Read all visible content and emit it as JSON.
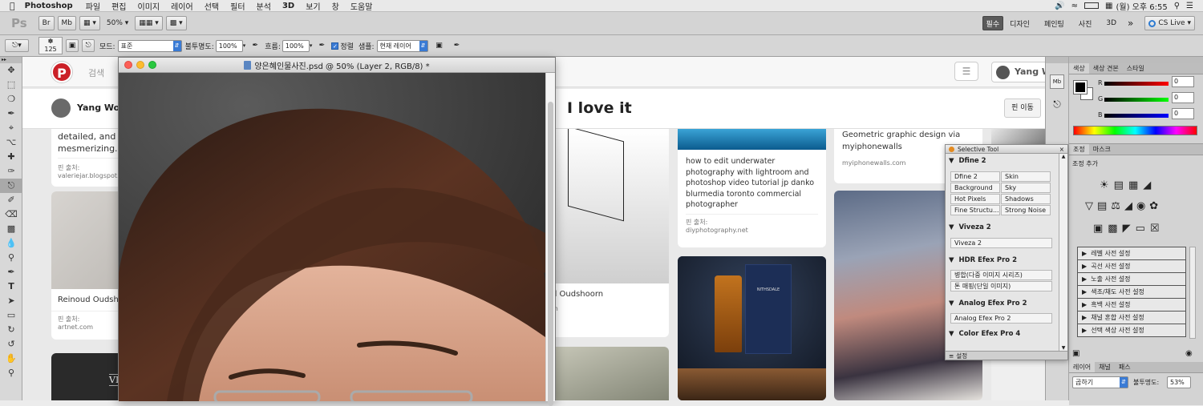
{
  "menubar": {
    "apple": "",
    "app": "Photoshop",
    "items": [
      "파일",
      "편집",
      "이미지",
      "레이어",
      "선택",
      "필터",
      "분석",
      "3D",
      "보기",
      "창",
      "도움말"
    ],
    "status": {
      "clock": "(월) 오후 6:55"
    }
  },
  "appbar": {
    "ps_logo": "Ps",
    "zoom": "50%",
    "workspaces": [
      "필수",
      "디자인",
      "페인팅",
      "사진",
      "3D"
    ],
    "more": "»",
    "cslive": "CS Live"
  },
  "options": {
    "brush_size": "125",
    "mode_label": "모드:",
    "mode_value": "표준",
    "opacity_label": "불투명도:",
    "opacity_value": "100%",
    "flow_label": "흐름:",
    "flow_value": "100%",
    "aligned_label": "정렬",
    "sample_label": "샘플:",
    "sample_value": "현재 레이어"
  },
  "pinterest": {
    "search_placeholder": "검색",
    "user": "Yang Woo",
    "user_short": "Yang W",
    "heading": "I love it",
    "move_pin": "핀 이동",
    "cards": [
      {
        "text": "detailed, and just mesmerizing.",
        "src_label": "핀 출처:",
        "src": "valeriejar.blogspot.co"
      },
      {
        "text": "Reinoud Oudshoo",
        "src_label": "핀 출처:",
        "src": "artnet.com"
      },
      {
        "text": "d Oudshoorn",
        "src": "m"
      },
      {
        "text": "how to edit underwater photography with lightroom and photoshop video tutorial jp danko blurmedia toronto commercial photographer",
        "src_label": "핀 출처:",
        "src": "diyphotography.net"
      },
      {
        "text": "Geometric graphic design via myiphonewalls",
        "src_label": "핀 출처:",
        "src": "myiphonewalls.com"
      }
    ],
    "dark_card_text1": "fr",
    "dark_card_text2": "VIDEO T",
    "bottle_label": "NITHSDALE"
  },
  "document": {
    "title": "양은혜인물사진.psd @ 50% (Layer 2, RGB/8) *"
  },
  "color_panel": {
    "tabs": [
      "색상",
      "색상 견본",
      "스타일"
    ],
    "r_label": "R",
    "r": "0",
    "g_label": "G",
    "g": "0",
    "b_label": "B",
    "b": "0"
  },
  "adjust_panel": {
    "tabs": [
      "조정",
      "마스크"
    ],
    "title": "조정 추가",
    "presets": [
      "레벨 사전 설정",
      "곡선 사전 설정",
      "노출 사전 설정",
      "색조/채도 사전 설정",
      "흑백 사전 설정",
      "채널 혼합 사전 설정",
      "선택 색상 사전 설정"
    ]
  },
  "layers_panel": {
    "tabs": [
      "레이어",
      "채널",
      "패스"
    ],
    "blend": "곱하기",
    "opacity_label": "불투명도:",
    "opacity": "53%"
  },
  "selective_tool": {
    "title": "Selective Tool",
    "groups": [
      {
        "name": "Dfine 2",
        "buttons": [
          "Dfine 2",
          "Skin",
          "Background",
          "Sky",
          "Hot Pixels",
          "Shadows",
          "Fine Structu...",
          "Strong Noise"
        ]
      },
      {
        "name": "Viveza 2",
        "buttons": [
          "Viveza 2"
        ]
      },
      {
        "name": "HDR Efex Pro 2",
        "buttons": [
          "병합(다중 이미지 시리즈)",
          "톤 매핑(단일 이미지)"
        ]
      },
      {
        "name": "Analog Efex Pro 2",
        "buttons": [
          "Analog Efex Pro 2"
        ]
      },
      {
        "name": "Color Efex Pro 4",
        "buttons": []
      }
    ],
    "footer": "설정"
  }
}
